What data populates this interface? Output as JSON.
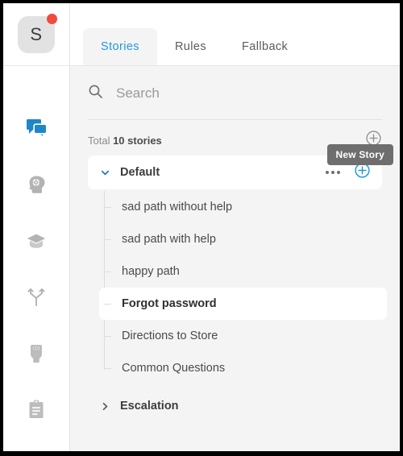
{
  "workspace": {
    "avatar_initial": "S",
    "notification_badge": true
  },
  "rail": {
    "items": [
      {
        "name": "conversations",
        "icon": "chat-bubbles-icon",
        "active": true
      },
      {
        "name": "ai-brain",
        "icon": "head-gear-icon",
        "active": false
      },
      {
        "name": "training",
        "icon": "graduation-cap-icon",
        "active": false
      },
      {
        "name": "branching",
        "icon": "branch-fork-icon",
        "active": false
      },
      {
        "name": "bot",
        "icon": "robot-head-icon",
        "active": false
      },
      {
        "name": "reports",
        "icon": "clipboard-icon",
        "active": false
      }
    ]
  },
  "tabs": [
    {
      "label": "Stories",
      "active": true
    },
    {
      "label": "Rules",
      "active": false
    },
    {
      "label": "Fallback",
      "active": false
    }
  ],
  "search": {
    "placeholder": "Search",
    "value": "",
    "icon": "search-icon"
  },
  "summary": {
    "total_prefix": "Total ",
    "total_count": "10 stories",
    "add_icon": "plus-circle-icon"
  },
  "tooltip": {
    "text": "New Story",
    "visible": true
  },
  "groups": [
    {
      "label": "Default",
      "expanded": true,
      "chevron": "chevron-down-icon",
      "menu_icon": "ellipsis-icon",
      "add_icon": "plus-circle-icon",
      "stories": [
        {
          "label": "sad path without help",
          "selected": false
        },
        {
          "label": "sad path with help",
          "selected": false
        },
        {
          "label": "happy path",
          "selected": false
        },
        {
          "label": "Forgot password",
          "selected": true
        },
        {
          "label": "Directions to Store",
          "selected": false
        },
        {
          "label": "Common Questions",
          "selected": false
        }
      ]
    },
    {
      "label": "Escalation",
      "expanded": false,
      "chevron": "chevron-right-icon",
      "stories": []
    }
  ],
  "colors": {
    "accent": "#1f9bdc",
    "badge": "#f04a41",
    "panel_bg": "#f4f4f4",
    "tooltip_bg": "#6e6e6e",
    "icon_gray": "#b0b0b0"
  }
}
